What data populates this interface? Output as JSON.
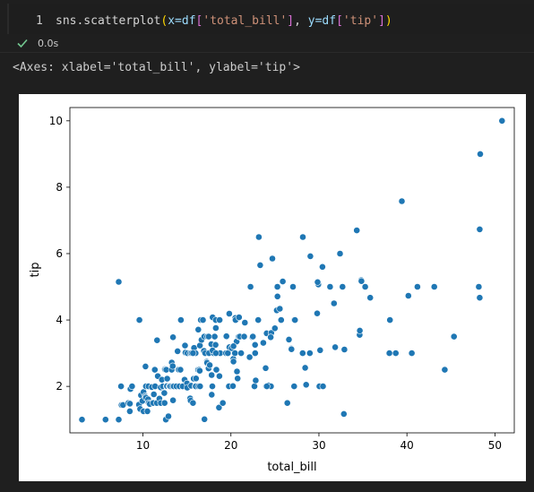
{
  "cell": {
    "line_number": "1",
    "code": {
      "fn": "sns.scatterplot",
      "open_paren": "(",
      "x_param": "x=df",
      "open_b1": "[",
      "x_str": "'total_bill'",
      "close_b1": "]",
      "sep": ", ",
      "y_param": "y=df",
      "open_b2": "[",
      "y_str": "'tip'",
      "close_b2": "]",
      "close_paren": ")"
    },
    "exec_time": "0.0s",
    "status_color": "#73c991"
  },
  "output": {
    "repr": "<Axes: xlabel='total_bill', ylabel='tip'>"
  },
  "chart_data": {
    "type": "scatter",
    "xlabel": "total_bill",
    "ylabel": "tip",
    "xlim": [
      1.7,
      52.2
    ],
    "ylim": [
      0.6,
      10.4
    ],
    "xticks": [
      10,
      20,
      30,
      40,
      50
    ],
    "yticks": [
      2,
      4,
      6,
      8,
      10
    ],
    "marker_color": "#1f77b4",
    "grid": false,
    "points": [
      [
        3.07,
        1.0
      ],
      [
        5.75,
        1.0
      ],
      [
        7.25,
        1.0
      ],
      [
        7.25,
        5.15
      ],
      [
        7.51,
        2.0
      ],
      [
        7.56,
        1.44
      ],
      [
        7.74,
        1.44
      ],
      [
        8.35,
        1.5
      ],
      [
        8.51,
        1.25
      ],
      [
        8.52,
        1.48
      ],
      [
        8.58,
        1.92
      ],
      [
        8.77,
        2.0
      ],
      [
        9.55,
        1.45
      ],
      [
        9.6,
        4.0
      ],
      [
        9.68,
        1.32
      ],
      [
        9.78,
        1.73
      ],
      [
        9.94,
        1.56
      ],
      [
        10.07,
        1.83
      ],
      [
        10.07,
        1.25
      ],
      [
        10.27,
        1.71
      ],
      [
        10.29,
        2.6
      ],
      [
        10.33,
        1.67
      ],
      [
        10.33,
        2.0
      ],
      [
        10.34,
        1.66
      ],
      [
        10.34,
        2.0
      ],
      [
        10.51,
        1.25
      ],
      [
        10.59,
        1.61
      ],
      [
        10.63,
        2.0
      ],
      [
        10.65,
        1.5
      ],
      [
        10.77,
        1.47
      ],
      [
        11.02,
        1.98
      ],
      [
        11.17,
        1.5
      ],
      [
        11.24,
        1.76
      ],
      [
        11.35,
        2.5
      ],
      [
        11.38,
        2.0
      ],
      [
        11.59,
        1.5
      ],
      [
        11.61,
        3.39
      ],
      [
        11.69,
        2.31
      ],
      [
        11.87,
        1.63
      ],
      [
        12.02,
        1.97
      ],
      [
        12.03,
        1.5
      ],
      [
        12.16,
        2.2
      ],
      [
        12.26,
        2.0
      ],
      [
        12.43,
        1.8
      ],
      [
        12.46,
        1.5
      ],
      [
        12.48,
        2.52
      ],
      [
        12.54,
        2.5
      ],
      [
        12.6,
        1.0
      ],
      [
        12.66,
        2.5
      ],
      [
        12.69,
        2.0
      ],
      [
        12.74,
        2.01
      ],
      [
        12.76,
        2.23
      ],
      [
        12.9,
        1.1
      ],
      [
        13.0,
        2.0
      ],
      [
        13.03,
        2.0
      ],
      [
        13.13,
        2.0
      ],
      [
        13.27,
        2.5
      ],
      [
        13.28,
        2.72
      ],
      [
        13.37,
        2.0
      ],
      [
        13.39,
        2.61
      ],
      [
        13.42,
        3.48
      ],
      [
        13.42,
        1.58
      ],
      [
        13.51,
        2.0
      ],
      [
        13.81,
        2.0
      ],
      [
        13.94,
        3.06
      ],
      [
        14.07,
        2.5
      ],
      [
        14.15,
        2.0
      ],
      [
        14.26,
        2.5
      ],
      [
        14.31,
        4.0
      ],
      [
        14.52,
        2.0
      ],
      [
        14.73,
        2.2
      ],
      [
        14.78,
        3.23
      ],
      [
        14.83,
        3.02
      ],
      [
        15.01,
        2.09
      ],
      [
        15.04,
        1.96
      ],
      [
        15.06,
        3.0
      ],
      [
        15.36,
        1.64
      ],
      [
        15.38,
        3.0
      ],
      [
        15.42,
        1.57
      ],
      [
        15.48,
        2.02
      ],
      [
        15.53,
        3.0
      ],
      [
        15.69,
        1.5
      ],
      [
        15.77,
        2.23
      ],
      [
        15.81,
        3.16
      ],
      [
        15.95,
        2.0
      ],
      [
        15.98,
        3.0
      ],
      [
        16.0,
        2.0
      ],
      [
        16.04,
        2.24
      ],
      [
        16.27,
        2.5
      ],
      [
        16.29,
        3.71
      ],
      [
        16.31,
        2.0
      ],
      [
        16.4,
        2.5
      ],
      [
        16.45,
        2.47
      ],
      [
        16.47,
        3.23
      ],
      [
        16.49,
        2.0
      ],
      [
        16.58,
        4.0
      ],
      [
        16.66,
        3.4
      ],
      [
        16.82,
        4.0
      ],
      [
        16.93,
        3.07
      ],
      [
        16.97,
        3.5
      ],
      [
        16.99,
        1.01
      ],
      [
        17.07,
        3.0
      ],
      [
        17.26,
        2.74
      ],
      [
        17.29,
        2.71
      ],
      [
        17.31,
        3.5
      ],
      [
        17.46,
        2.54
      ],
      [
        17.47,
        3.5
      ],
      [
        17.51,
        3.0
      ],
      [
        17.59,
        2.64
      ],
      [
        17.78,
        3.27
      ],
      [
        17.81,
        2.34
      ],
      [
        17.82,
        1.75
      ],
      [
        17.89,
        2.0
      ],
      [
        17.92,
        4.08
      ],
      [
        18.04,
        3.0
      ],
      [
        18.15,
        3.5
      ],
      [
        18.24,
        3.76
      ],
      [
        18.26,
        3.25
      ],
      [
        18.28,
        4.0
      ],
      [
        18.29,
        3.76
      ],
      [
        18.35,
        2.5
      ],
      [
        18.43,
        3.0
      ],
      [
        18.64,
        1.36
      ],
      [
        18.69,
        2.31
      ],
      [
        18.71,
        4.0
      ],
      [
        18.78,
        3.0
      ],
      [
        19.08,
        1.5
      ],
      [
        19.44,
        3.0
      ],
      [
        19.49,
        3.51
      ],
      [
        19.65,
        3.0
      ],
      [
        19.77,
        2.0
      ],
      [
        19.81,
        4.19
      ],
      [
        19.82,
        3.18
      ],
      [
        20.08,
        3.15
      ],
      [
        20.23,
        2.01
      ],
      [
        20.27,
        2.83
      ],
      [
        20.29,
        2.75
      ],
      [
        20.29,
        3.21
      ],
      [
        20.45,
        3.0
      ],
      [
        20.49,
        4.06
      ],
      [
        20.53,
        4.0
      ],
      [
        20.65,
        3.35
      ],
      [
        20.69,
        2.45
      ],
      [
        20.76,
        2.24
      ],
      [
        20.9,
        3.5
      ],
      [
        20.92,
        4.08
      ],
      [
        21.01,
        3.5
      ],
      [
        21.16,
        3.0
      ],
      [
        21.5,
        3.5
      ],
      [
        21.58,
        3.92
      ],
      [
        22.12,
        2.88
      ],
      [
        22.23,
        5.0
      ],
      [
        22.42,
        3.48
      ],
      [
        22.49,
        3.5
      ],
      [
        22.67,
        2.0
      ],
      [
        22.75,
        3.25
      ],
      [
        22.76,
        3.0
      ],
      [
        22.82,
        2.18
      ],
      [
        23.1,
        4.0
      ],
      [
        23.17,
        6.5
      ],
      [
        23.33,
        5.65
      ],
      [
        23.68,
        3.31
      ],
      [
        23.95,
        2.55
      ],
      [
        24.01,
        2.0
      ],
      [
        24.06,
        3.6
      ],
      [
        24.27,
        2.03
      ],
      [
        24.52,
        3.48
      ],
      [
        24.55,
        2.0
      ],
      [
        24.59,
        3.61
      ],
      [
        24.71,
        5.85
      ],
      [
        25.0,
        3.75
      ],
      [
        25.21,
        4.29
      ],
      [
        25.28,
        5.0
      ],
      [
        25.29,
        4.71
      ],
      [
        25.56,
        4.34
      ],
      [
        25.71,
        4.0
      ],
      [
        25.89,
        5.16
      ],
      [
        26.41,
        1.5
      ],
      [
        26.59,
        3.41
      ],
      [
        26.86,
        3.14
      ],
      [
        26.88,
        3.12
      ],
      [
        27.05,
        5.0
      ],
      [
        27.18,
        2.0
      ],
      [
        27.2,
        4.0
      ],
      [
        27.28,
        4.0
      ],
      [
        28.15,
        3.0
      ],
      [
        28.17,
        6.5
      ],
      [
        28.44,
        2.56
      ],
      [
        28.55,
        2.05
      ],
      [
        28.97,
        3.0
      ],
      [
        29.03,
        5.92
      ],
      [
        29.8,
        4.2
      ],
      [
        29.85,
        5.14
      ],
      [
        29.93,
        5.07
      ],
      [
        30.06,
        2.0
      ],
      [
        30.14,
        3.09
      ],
      [
        30.4,
        5.6
      ],
      [
        30.46,
        2.0
      ],
      [
        31.27,
        5.0
      ],
      [
        31.71,
        4.5
      ],
      [
        31.85,
        3.18
      ],
      [
        32.4,
        6.0
      ],
      [
        32.68,
        5.0
      ],
      [
        32.83,
        1.17
      ],
      [
        32.9,
        3.11
      ],
      [
        34.3,
        6.7
      ],
      [
        34.63,
        3.55
      ],
      [
        34.65,
        3.68
      ],
      [
        34.81,
        5.2
      ],
      [
        35.26,
        5.0
      ],
      [
        35.83,
        4.67
      ],
      [
        38.01,
        3.0
      ],
      [
        38.07,
        4.0
      ],
      [
        38.73,
        3.0
      ],
      [
        39.42,
        7.58
      ],
      [
        40.17,
        4.73
      ],
      [
        40.55,
        3.0
      ],
      [
        41.19,
        5.0
      ],
      [
        43.11,
        5.0
      ],
      [
        44.3,
        2.5
      ],
      [
        45.35,
        3.5
      ],
      [
        48.17,
        5.0
      ],
      [
        48.27,
        4.67
      ],
      [
        48.33,
        9.0
      ],
      [
        50.81,
        10.0
      ],
      [
        34.83,
        5.17
      ],
      [
        24.08,
        2.0
      ],
      [
        15.69,
        3.0
      ],
      [
        17.92,
        3.08
      ],
      [
        12.43,
        1.8
      ],
      [
        18.29,
        3.0
      ],
      [
        17.59,
        2.64
      ],
      [
        20.29,
        3.21
      ],
      [
        22.49,
        3.5
      ],
      [
        28.97,
        3.0
      ],
      [
        29.85,
        5.14
      ],
      [
        24.52,
        3.48
      ],
      [
        48.27,
        6.73
      ]
    ]
  }
}
